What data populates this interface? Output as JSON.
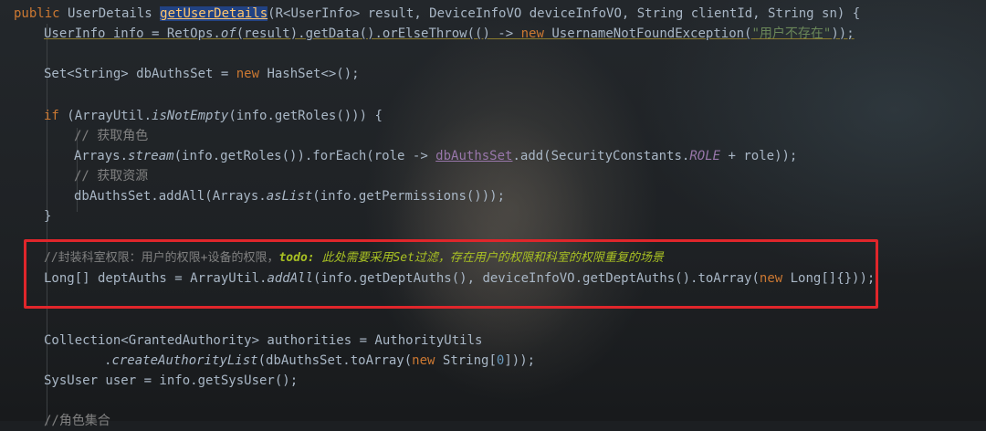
{
  "code": {
    "l1": {
      "kw_public": "public",
      "type": " UserDetails ",
      "method": "getUserDetails",
      "params_a": "(R<UserInfo> result, DeviceInfoVO deviceInfoVO, String clientId, String sn) {"
    },
    "l2": {
      "a": "UserInfo info = RetOps.",
      "of": "of",
      "b": "(result).getData().orElseThrow(() -> ",
      "kw_new": "new",
      "c": " UsernameNotFoundException(",
      "str": "\"用户不存在\"",
      "d": "));"
    },
    "l3": {
      "a": "Set<String> dbAuthsSet = ",
      "kw_new": "new",
      "b": " HashSet<>();"
    },
    "l4": {
      "kw_if": "if",
      "a": " (ArrayUtil.",
      "m": "isNotEmpty",
      "b": "(info.getRoles())) {"
    },
    "l5": {
      "cmt": "// 获取角色"
    },
    "l6": {
      "a": "Arrays.",
      "m": "stream",
      "b": "(info.getRoles()).forEach(role -> ",
      "fld": "dbAuthsSet",
      "c": ".add(SecurityConstants.",
      "cst": "ROLE",
      "d": " + role));"
    },
    "l7": {
      "cmt": "// 获取资源"
    },
    "l8": {
      "a": "dbAuthsSet.addAll(Arrays.",
      "m": "asList",
      "b": "(info.getPermissions()));"
    },
    "l9": {
      "a": "}"
    },
    "l10": {
      "cmt": "//封装科室权限：用户的权限+设备的权限，",
      "todo": "todo:",
      "todo_text": " 此处需要采用Set过滤，存在用户的权限和科室的权限重复的场景"
    },
    "l11": {
      "a": "Long[] deptAuths = ArrayUtil.",
      "m": "addAll",
      "b": "(info.getDeptAuths(), deviceInfoVO.getDeptAuths().toArray(",
      "kw_new": "new",
      "c": " Long[]{}));"
    },
    "l12": {
      "a": "Collection<GrantedAuthority> authorities = AuthorityUtils"
    },
    "l13": {
      "a": ".",
      "m": "createAuthorityList",
      "b": "(dbAuthsSet.toArray(",
      "kw_new": "new",
      "c": " String[",
      "num": "0",
      "d": "]));"
    },
    "l14": {
      "a": "SysUser user = info.getSysUser();"
    },
    "l15": {
      "cmt": "//角色集合"
    }
  },
  "colors": {
    "keyword": "#cc7832",
    "method_decl": "#ffc66d",
    "string": "#6a8759",
    "comment": "#808080",
    "todo": "#a8c023",
    "highlight_box": "#e0262b"
  }
}
